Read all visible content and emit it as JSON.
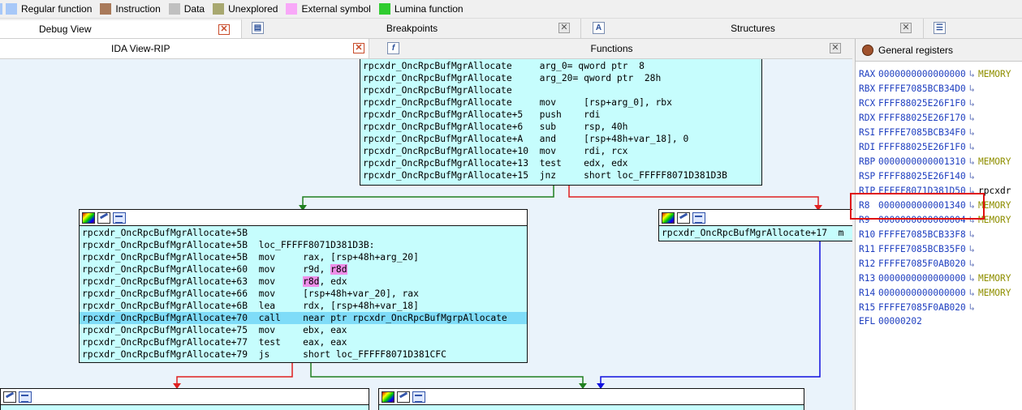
{
  "legend": [
    {
      "label": "Regular function",
      "color": "#a7c8f8"
    },
    {
      "label": "Instruction",
      "color": "#a97a5a"
    },
    {
      "label": "Data",
      "color": "#c0c0c0"
    },
    {
      "label": "Unexplored",
      "color": "#a8a870"
    },
    {
      "label": "External symbol",
      "color": "#f8a8f8"
    },
    {
      "label": "Lumina function",
      "color": "#30cc30"
    }
  ],
  "tabs_top": [
    {
      "label": "Debug View",
      "icon": "none"
    },
    {
      "label": "Breakpoints",
      "icon": "breakpoints-icon"
    },
    {
      "label": "Structures",
      "icon": "structures-icon"
    }
  ],
  "tabs_second": [
    {
      "label": "IDA View-RIP"
    },
    {
      "label": "Functions",
      "icon": "f"
    }
  ],
  "registers_title": "General registers",
  "node_top": [
    {
      "addr": "rpcxdr_OncRpcBufMgrAllocate",
      "mn": "arg_0=",
      "op": " qword ptr  8"
    },
    {
      "addr": "rpcxdr_OncRpcBufMgrAllocate",
      "mn": "arg_20=",
      "op": " qword ptr  28h"
    },
    {
      "addr": "rpcxdr_OncRpcBufMgrAllocate",
      "mn": "",
      "op": ""
    },
    {
      "addr": "rpcxdr_OncRpcBufMgrAllocate",
      "mn": "mov",
      "op": "[rsp+arg_0], rbx"
    },
    {
      "addr": "rpcxdr_OncRpcBufMgrAllocate+5",
      "mn": "push",
      "op": "rdi"
    },
    {
      "addr": "rpcxdr_OncRpcBufMgrAllocate+6",
      "mn": "sub",
      "op": "rsp, 40h"
    },
    {
      "addr": "rpcxdr_OncRpcBufMgrAllocate+A",
      "mn": "and",
      "op": "[rsp+48h+var_18], 0"
    },
    {
      "addr": "rpcxdr_OncRpcBufMgrAllocate+10",
      "mn": "mov",
      "op": "rdi, rcx"
    },
    {
      "addr": "rpcxdr_OncRpcBufMgrAllocate+13",
      "mn": "test",
      "op": "edx, edx"
    },
    {
      "addr": "rpcxdr_OncRpcBufMgrAllocate+15",
      "mn": "jnz",
      "op": "short loc_FFFFF8071D381D3B"
    }
  ],
  "node_left": [
    {
      "addr": "rpcxdr_OncRpcBufMgrAllocate+5B",
      "mn": "",
      "op": ""
    },
    {
      "addr": "rpcxdr_OncRpcBufMgrAllocate+5B",
      "mn": "loc_FFFFF8071D381D3B:",
      "op": ""
    },
    {
      "addr": "rpcxdr_OncRpcBufMgrAllocate+5B",
      "mn": "mov",
      "op": "rax, [rsp+48h+arg_20]"
    },
    {
      "addr": "rpcxdr_OncRpcBufMgrAllocate+60",
      "mn": "mov",
      "op": "r9d, ",
      "hl": "r8d"
    },
    {
      "addr": "rpcxdr_OncRpcBufMgrAllocate+63",
      "mn": "mov",
      "op": "",
      "hl_pre": "r8d",
      "post": ", edx"
    },
    {
      "addr": "rpcxdr_OncRpcBufMgrAllocate+66",
      "mn": "mov",
      "op": "[rsp+48h+var_20], rax"
    },
    {
      "addr": "rpcxdr_OncRpcBufMgrAllocate+6B",
      "mn": "lea",
      "op": "rdx, [rsp+48h+var_18]"
    },
    {
      "addr": "rpcxdr_OncRpcBufMgrAllocate+70",
      "mn": "call",
      "op": "near ptr rpcxdr_OncRpcBufMgrpAllocate",
      "current": true
    },
    {
      "addr": "rpcxdr_OncRpcBufMgrAllocate+75",
      "mn": "mov",
      "op": "ebx, eax"
    },
    {
      "addr": "rpcxdr_OncRpcBufMgrAllocate+77",
      "mn": "test",
      "op": "eax, eax"
    },
    {
      "addr": "rpcxdr_OncRpcBufMgrAllocate+79",
      "mn": "js",
      "op": "short loc_FFFFF8071D381CFC"
    }
  ],
  "node_right": [
    {
      "addr": "rpcxdr_OncRpcBufMgrAllocate+17",
      "mn": "m",
      "op": ""
    }
  ],
  "registers": [
    {
      "name": "RAX",
      "value": "0000000000000000",
      "arrow": "↳",
      "note": "MEMORY",
      "kind": "mem"
    },
    {
      "name": "RBX",
      "value": "FFFFE7085BCB34D0",
      "arrow": "↳",
      "note": "",
      "kind": ""
    },
    {
      "name": "RCX",
      "value": "FFFF88025E26F1F0",
      "arrow": "↳",
      "note": "",
      "kind": ""
    },
    {
      "name": "RDX",
      "value": "FFFF88025E26F170",
      "arrow": "↳",
      "note": "",
      "kind": ""
    },
    {
      "name": "RSI",
      "value": "FFFFE7085BCB34F0",
      "arrow": "↳",
      "note": "",
      "kind": ""
    },
    {
      "name": "RDI",
      "value": "FFFF88025E26F1F0",
      "arrow": "↳",
      "note": "",
      "kind": ""
    },
    {
      "name": "RBP",
      "value": "0000000000001310",
      "arrow": "↳",
      "note": "MEMORY",
      "kind": "mem"
    },
    {
      "name": "RSP",
      "value": "FFFF88025E26F140",
      "arrow": "↳",
      "note": "",
      "kind": ""
    },
    {
      "name": "RIP",
      "value": "FFFFF8071D381D50",
      "arrow": "↳",
      "note": "rpcxdr",
      "kind": "sym"
    },
    {
      "name": "R8",
      "value": "0000000000001340",
      "arrow": "↳",
      "note": "MEMORY",
      "kind": "mem"
    },
    {
      "name": "R9",
      "value": "0000000000000004",
      "arrow": "↳",
      "note": "MEMORY",
      "kind": "mem"
    },
    {
      "name": "R10",
      "value": "FFFFE7085BCB33F8",
      "arrow": "↳",
      "note": "",
      "kind": ""
    },
    {
      "name": "R11",
      "value": "FFFFE7085BCB35F0",
      "arrow": "↳",
      "note": "",
      "kind": ""
    },
    {
      "name": "R12",
      "value": "FFFFE7085F0AB020",
      "arrow": "↳",
      "note": "",
      "kind": ""
    },
    {
      "name": "R13",
      "value": "0000000000000000",
      "arrow": "↳",
      "note": "MEMORY",
      "kind": "mem"
    },
    {
      "name": "R14",
      "value": "0000000000000000",
      "arrow": "↳",
      "note": "MEMORY",
      "kind": "mem"
    },
    {
      "name": "R15",
      "value": "FFFFE7085F0AB020",
      "arrow": "↳",
      "note": "",
      "kind": ""
    },
    {
      "name": "EFL",
      "value": "00000202",
      "arrow": "",
      "note": "",
      "kind": ""
    }
  ],
  "colors": {
    "node_bg": "#c6fdfd",
    "graph_bg": "#eaf3fb",
    "edge_green": "#208020",
    "edge_red": "#e02020",
    "edge_blue": "#1010e0",
    "highlight_line": "#7fdcf8",
    "register_blue": "#1f3fc0"
  }
}
